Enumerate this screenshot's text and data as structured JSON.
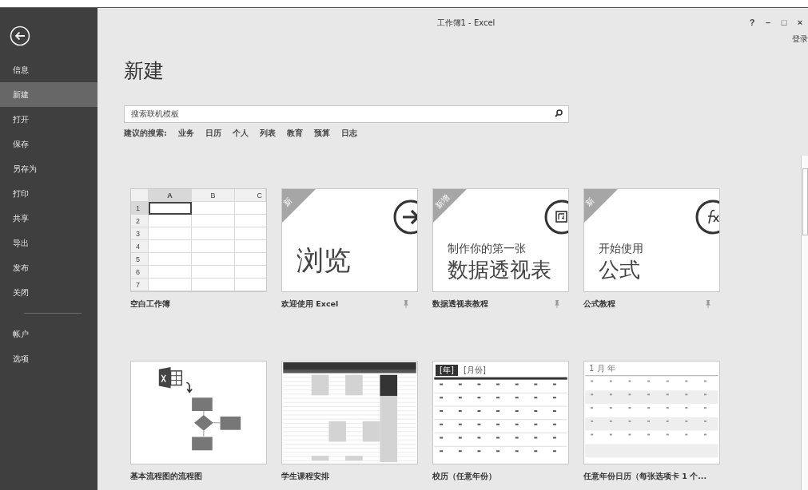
{
  "window": {
    "title": "工作簿1 - Excel",
    "controls": [
      "?",
      "–",
      "□",
      "×"
    ],
    "sign_in": "登录"
  },
  "sidebar": {
    "items": [
      {
        "label": "信息",
        "selected": false
      },
      {
        "label": "新建",
        "selected": true
      },
      {
        "label": "打开",
        "selected": false
      },
      {
        "label": "保存",
        "selected": false
      },
      {
        "label": "另存为",
        "selected": false
      },
      {
        "label": "打印",
        "selected": false
      },
      {
        "label": "共享",
        "selected": false
      },
      {
        "label": "导出",
        "selected": false
      },
      {
        "label": "发布",
        "selected": false
      },
      {
        "label": "关闭",
        "selected": false
      }
    ],
    "bottom_items": [
      {
        "label": "帐户",
        "selected": false
      },
      {
        "label": "选项",
        "selected": false
      }
    ]
  },
  "page": {
    "title": "新建",
    "search": {
      "placeholder": "搜索联机模板"
    },
    "suggestions_label": "建议的搜索:",
    "suggestions": [
      "业务",
      "日历",
      "个人",
      "列表",
      "教育",
      "预算",
      "日志"
    ]
  },
  "templates": [
    {
      "kind": "blank",
      "label": "空白工作簿",
      "columns": [
        "A",
        "B",
        "C"
      ],
      "rows": [
        "1",
        "2",
        "3",
        "4",
        "5",
        "6",
        "7"
      ]
    },
    {
      "kind": "browse",
      "label": "欢迎使用 Excel",
      "badge": "新",
      "headline": "浏览"
    },
    {
      "kind": "pivot",
      "label": "数据透视表教程",
      "badge": "新增",
      "subtitle": "制作你的第一张",
      "headline": "数据透视表"
    },
    {
      "kind": "formula",
      "label": "公式教程",
      "badge": "新",
      "subtitle": "开始使用",
      "headline": "公式"
    },
    {
      "kind": "flowchart",
      "label": "基本流程图的流程图"
    },
    {
      "kind": "schedule",
      "label": "学生课程安排"
    },
    {
      "kind": "calendar",
      "label": "校历（任意年份）",
      "year": "[年]",
      "month": "[月份]"
    },
    {
      "kind": "yearcalendar",
      "label": "任意年份日历（每张选项卡 1 个...",
      "heading": "1 月 年"
    }
  ]
}
